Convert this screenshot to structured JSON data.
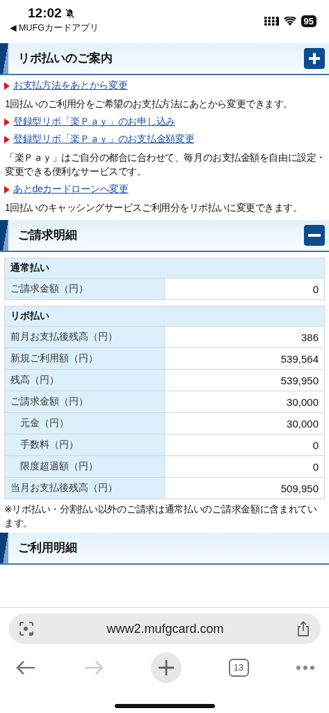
{
  "status_bar": {
    "time": "12:02",
    "back_label": "◀ MUFGカードアプリ",
    "battery": "95"
  },
  "sections": [
    {
      "title": "リボ払いのご案内",
      "expanded": false,
      "items": [
        {
          "kind": "link",
          "text": "お支払方法をあとから変更"
        },
        {
          "kind": "text",
          "text": "1回払いのご利用分をご希望のお支払方法にあとから変更できます。"
        },
        {
          "kind": "link",
          "text": "登録型リボ「楽Ｐａｙ」のお申し込み"
        },
        {
          "kind": "link",
          "text": "登録型リボ「楽Ｐａｙ」のお支払金額変更"
        },
        {
          "kind": "text",
          "text": "「楽Ｐａｙ」はご自分の都合に合わせて、毎月のお支払金額を自由に設定・変更できる便利なサービスです。"
        },
        {
          "kind": "link",
          "text": "あとdeカードローンへ変更"
        },
        {
          "kind": "text",
          "text": "1回払いのキャッシングサービスご利用分をリボ払いに変更できます。"
        }
      ]
    },
    {
      "title": "ご請求明細",
      "expanded": true,
      "tables": [
        {
          "heading": "通常払い",
          "rows": [
            {
              "label": "ご請求金額（円）",
              "value": "0",
              "indented": false
            }
          ]
        },
        {
          "heading": "リボ払い",
          "rows": [
            {
              "label": "前月お支払後残高（円）",
              "value": "386",
              "indented": false
            },
            {
              "label": "新規ご利用額（円）",
              "value": "539,564",
              "indented": false
            },
            {
              "label": "残高（円）",
              "value": "539,950",
              "indented": false
            },
            {
              "label": "ご請求金額（円）",
              "value": "30,000",
              "indented": false
            },
            {
              "label": "元金（円）",
              "value": "30,000",
              "indented": true
            },
            {
              "label": "手数料（円）",
              "value": "0",
              "indented": true
            },
            {
              "label": "限度超過額（円）",
              "value": "0",
              "indented": true
            },
            {
              "label": "当月お支払後残高（円）",
              "value": "509,950",
              "indented": false
            }
          ]
        }
      ],
      "note": "※リボ払い・分割払い以外のご請求は通常払いのご請求金額に含まれています。"
    },
    {
      "title": "ご利用明細"
    }
  ],
  "browser": {
    "url": "www2.mufgcard.com",
    "tab_count": "13",
    "back_disabled": false,
    "forward_disabled": true
  }
}
